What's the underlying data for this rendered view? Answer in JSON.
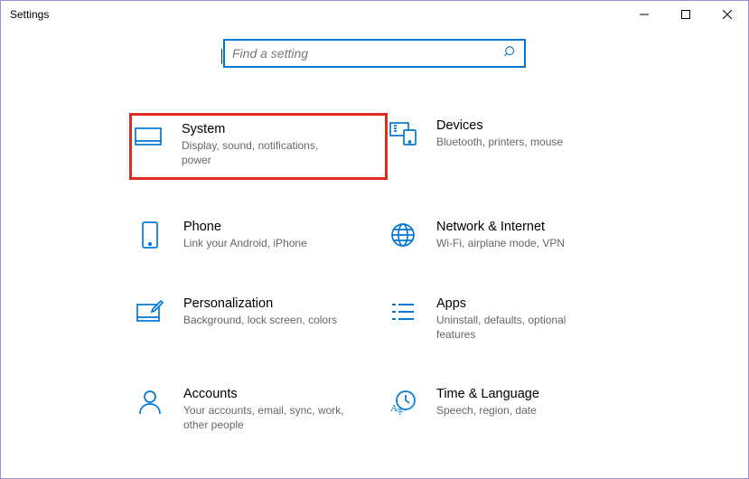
{
  "window": {
    "title": "Settings"
  },
  "search": {
    "placeholder": "Find a setting",
    "value": ""
  },
  "tiles": [
    {
      "id": "system",
      "title": "System",
      "desc": "Display, sound, notifications, power",
      "highlighted": true
    },
    {
      "id": "devices",
      "title": "Devices",
      "desc": "Bluetooth, printers, mouse",
      "highlighted": false
    },
    {
      "id": "phone",
      "title": "Phone",
      "desc": "Link your Android, iPhone",
      "highlighted": false
    },
    {
      "id": "network",
      "title": "Network & Internet",
      "desc": "Wi-Fi, airplane mode, VPN",
      "highlighted": false
    },
    {
      "id": "personalization",
      "title": "Personalization",
      "desc": "Background, lock screen, colors",
      "highlighted": false
    },
    {
      "id": "apps",
      "title": "Apps",
      "desc": "Uninstall, defaults, optional features",
      "highlighted": false
    },
    {
      "id": "accounts",
      "title": "Accounts",
      "desc": "Your accounts, email, sync, work, other people",
      "highlighted": false
    },
    {
      "id": "time",
      "title": "Time & Language",
      "desc": "Speech, region, date",
      "highlighted": false
    }
  ],
  "accent": "#0078d7",
  "highlight_color": "#e02a1f"
}
